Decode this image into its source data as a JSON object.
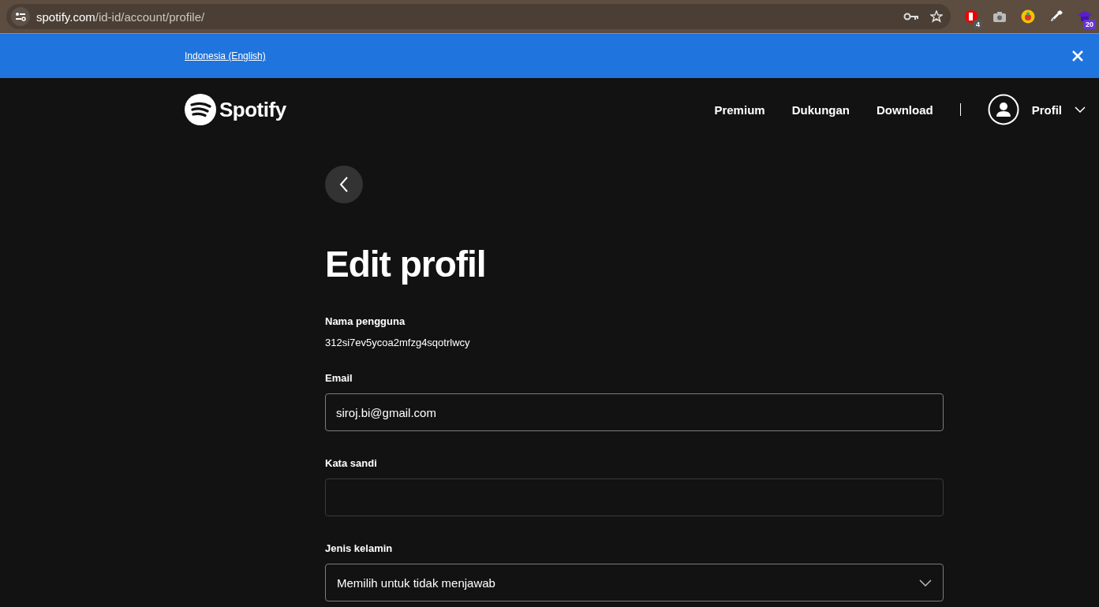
{
  "browser": {
    "url_host": "spotify.com",
    "url_path": "/id-id/account/profile/",
    "extensions": [
      {
        "kind": "stop",
        "badge": "4"
      },
      {
        "kind": "camera"
      },
      {
        "kind": "bug"
      },
      {
        "kind": "picker"
      },
      {
        "kind": "cap",
        "badge": "20"
      }
    ]
  },
  "banner": {
    "link": "Indonesia (English)"
  },
  "header": {
    "logo": "Spotify",
    "nav": [
      {
        "label": "Premium"
      },
      {
        "label": "Dukungan"
      },
      {
        "label": "Download"
      }
    ],
    "profile": "Profil"
  },
  "page": {
    "title": "Edit profil",
    "username_label": "Nama pengguna",
    "username": "312si7ev5ycoa2mfzg4sqotrlwcy",
    "fields": [
      {
        "kind": "text",
        "label": "Email",
        "value": "siroj.bi@gmail.com"
      },
      {
        "kind": "password",
        "label": "Kata sandi"
      },
      {
        "kind": "select",
        "label": "Jenis kelamin",
        "value": "Memilih untuk tidak menjawab"
      }
    ]
  }
}
